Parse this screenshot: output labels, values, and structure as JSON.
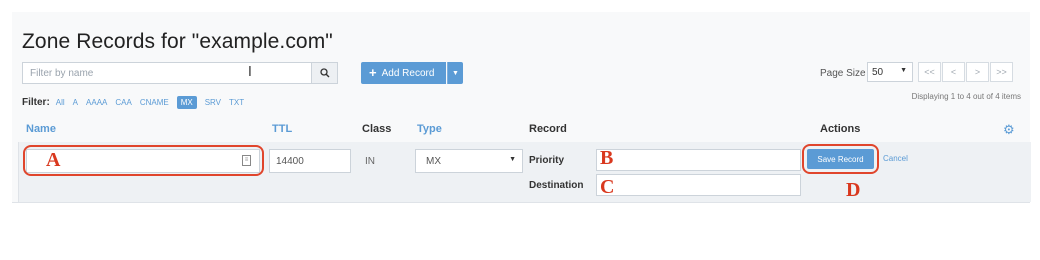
{
  "header": {
    "title": "Zone Records for \"example.com\""
  },
  "toolbar": {
    "filter_placeholder": "Filter by name",
    "add_record_label": "Add Record",
    "page_size_label": "Page Size",
    "page_size_value": "50",
    "pager": [
      "<<",
      "<",
      ">",
      ">>"
    ],
    "displaying_text": "Displaying 1 to 4 out of 4 items"
  },
  "filter": {
    "label": "Filter:",
    "options": [
      "All",
      "A",
      "AAAA",
      "CAA",
      "CNAME",
      "MX",
      "SRV",
      "TXT"
    ],
    "active": "MX"
  },
  "table": {
    "headers": {
      "name": "Name",
      "ttl": "TTL",
      "class": "Class",
      "type": "Type",
      "record": "Record",
      "actions": "Actions"
    },
    "edit_row": {
      "name_value": "",
      "ttl_value": "14400",
      "class_value": "IN",
      "type_value": "MX",
      "priority_label": "Priority",
      "priority_value": "",
      "destination_label": "Destination",
      "destination_value": "",
      "save_label": "Save Record",
      "cancel_label": "Cancel"
    }
  },
  "annotations": {
    "a": "A",
    "b": "B",
    "c": "C",
    "d": "D",
    "color": "#e0452c"
  },
  "colors": {
    "accent": "#5b9bd5"
  }
}
